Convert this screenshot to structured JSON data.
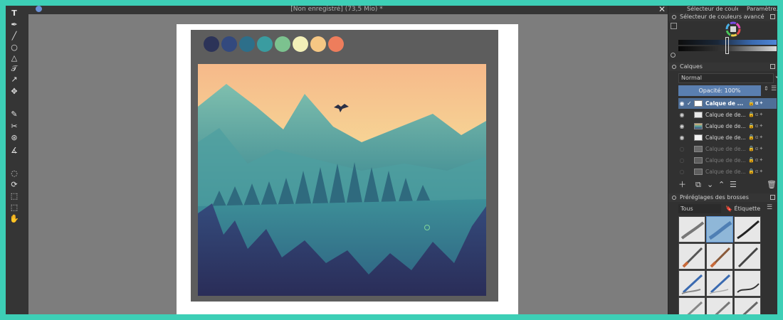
{
  "window": {
    "title": "[Non enregistré] (73,5 Mio) *"
  },
  "dock_tabs": [
    "Sélecteur de coule...",
    "Paramètre..."
  ],
  "colors": {
    "accent": "#5a7fb0",
    "palette": [
      "#2c3358",
      "#33497e",
      "#2d6f8a",
      "#3a9ca0",
      "#7cc28f",
      "#f3f0b8",
      "#f6c784",
      "#ee7d5c"
    ]
  },
  "color_selector": {
    "title": "Sélecteur de couleurs avancé"
  },
  "layers": {
    "title": "Calques",
    "blend_mode": "Normal",
    "opacity": "Opacité:  100%",
    "items": [
      {
        "name": "Calque de ...",
        "visible": true,
        "selected": true
      },
      {
        "name": "Calque de de...",
        "visible": true,
        "selected": false
      },
      {
        "name": "Calque de de...",
        "visible": true,
        "selected": false
      },
      {
        "name": "Calque de de...",
        "visible": true,
        "selected": false
      },
      {
        "name": "Calque de de...",
        "visible": false,
        "selected": false
      },
      {
        "name": "Calque de de...",
        "visible": false,
        "selected": false
      },
      {
        "name": "Calque de de...",
        "visible": false,
        "selected": false
      }
    ]
  },
  "brushes": {
    "title": "Préréglages des brosses",
    "filter": "Tous",
    "tag": "Étiquette"
  }
}
